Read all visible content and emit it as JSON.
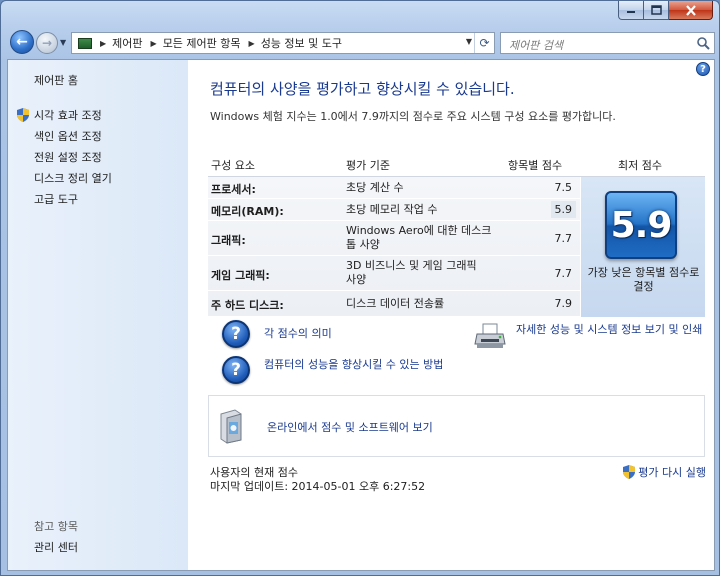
{
  "window": {
    "address": {
      "crumbs": [
        "제어판",
        "모든 제어판 항목",
        "성능 정보 및 도구"
      ]
    },
    "search": {
      "placeholder": "제어판 검색"
    }
  },
  "sidebar": {
    "home": "제어판 홈",
    "items": [
      {
        "label": "시각 효과 조정",
        "shield": true
      },
      {
        "label": "색인 옵션 조정",
        "shield": false
      },
      {
        "label": "전원 설정 조정",
        "shield": false
      },
      {
        "label": "디스크 정리 열기",
        "shield": false
      },
      {
        "label": "고급 도구",
        "shield": false
      }
    ],
    "see_also": "참고 항목",
    "action_center": "관리 센터"
  },
  "main": {
    "title": "컴퓨터의 사양을 평가하고 향상시킬 수 있습니다.",
    "description": "Windows 체험 지수는 1.0에서 7.9까지의 점수로 주요 시스템 구성 요소를 평가합니다.",
    "table": {
      "headers": {
        "component": "구성 요소",
        "criteria": "평가 기준",
        "subscore": "항목별 점수",
        "base": "최저 점수"
      },
      "rows": [
        {
          "component": "프로세서:",
          "criteria": "초당 계산 수",
          "score": "7.5",
          "lowest": false
        },
        {
          "component": "메모리(RAM):",
          "criteria": "초당 메모리 작업 수",
          "score": "5.9",
          "lowest": true
        },
        {
          "component": "그래픽:",
          "criteria": "Windows Aero에 대한 데스크톱 사양",
          "score": "7.7",
          "lowest": false
        },
        {
          "component": "게임 그래픽:",
          "criteria": "3D 비즈니스 및 게임 그래픽 사양",
          "score": "7.7",
          "lowest": false
        },
        {
          "component": "주 하드 디스크:",
          "criteria": "디스크 데이터 전송률",
          "score": "7.9",
          "lowest": false
        }
      ],
      "base_score": "5.9",
      "base_note": "가장 낮은 항목별 점수로 결정"
    },
    "links": {
      "score_meaning": "각 점수의 의미",
      "improve": "컴퓨터의 성능을 향상시킬 수 있는 방법",
      "details": "자세한 성능 및 시스템 정보 보기 및 인쇄",
      "online": "온라인에서 점수 및 소프트웨어 보기"
    },
    "footer": {
      "current_label": "사용자의 현재 점수",
      "last_update": "마지막 업데이트: 2014-05-01 오후 6:27:52",
      "rerun": "평가 다시 실행"
    }
  }
}
